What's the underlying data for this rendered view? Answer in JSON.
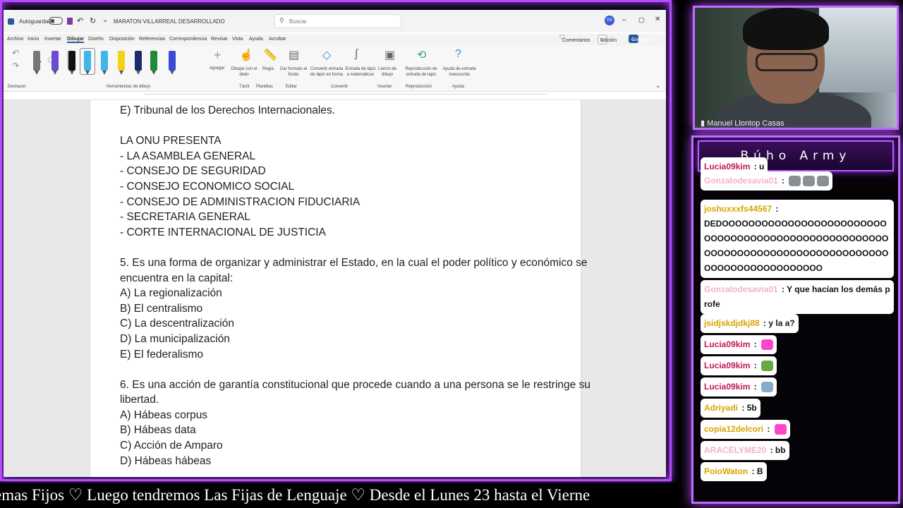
{
  "word": {
    "autosave_label": "Autoguardado",
    "doc_title": "MARATON VILLARREAL DESARROLLADO",
    "search_placeholder": "Buscar",
    "avatar_initials": "SS",
    "tabs": [
      "Archivo",
      "Inicio",
      "Insertar",
      "Dibujar",
      "Diseño",
      "Disposición",
      "Referencias",
      "Correspondencia",
      "Revisar",
      "Vista",
      "Ayuda",
      "Acrobat"
    ],
    "comments_label": "Comentarios",
    "edit_label": "Edición",
    "share_label": "Compartir",
    "ribbon": {
      "undo_group": "Deshacer",
      "tools_group": "Herramientas de dibujo",
      "add_label": "Agregar",
      "draw_finger": "Dibujar con el dedo",
      "ruler": "Regla",
      "format_bg": "Dar formato al fondo",
      "ink_to_text": "Convertir entrada de lápiz en forma",
      "ink_math": "Entrada de lápiz a matemáticas",
      "canvas": "Lienzo de dibujo",
      "replay": "Reproducción de entrada de lápiz",
      "help_ink": "Ayuda de entrada manuscrita",
      "group_tactil": "Táctil",
      "group_plantillas": "Plantillas",
      "group_editar": "Editar",
      "group_convertir": "Convertir",
      "group_insertar": "Insertar",
      "group_reproduccion": "Reproducción",
      "group_ayuda": "Ayuda"
    },
    "pen_colors": [
      "#777777",
      "#6a4bd1",
      "#111111",
      "#3fb6e8",
      "#3fb6e8",
      "#f2d21b",
      "#1a2a6e",
      "#1c8b3c",
      "#3a4bd8"
    ],
    "doc_lines": [
      "E) Tribunal de los Derechos Internacionales.",
      "",
      "LA ONU PRESENTA",
      "- LA ASAMBLEA GENERAL",
      "- CONSEJO DE SEGURIDAD",
      "- CONSEJO ECONOMICO SOCIAL",
      "- CONSEJO DE ADMINISTRACION FIDUCIARIA",
      "- SECRETARIA GENERAL",
      "- CORTE INTERNACIONAL DE JUSTICIA",
      "",
      "5. Es una forma de organizar y administrar el Estado, en la cual el poder político y económico se",
      "encuentra en la capital:",
      "A) La regionalización",
      "B) El centralismo",
      "C) La descentralización",
      "D) La municipalización",
      "E) El federalismo",
      "",
      "6. Es una acción de garantía constitucional que procede cuando a una persona se le restringe su",
      "libertad.",
      "A) Hábeas corpus",
      "B) Hábeas data",
      "C) Acción de Amparo",
      "D) Hábeas hábeas"
    ]
  },
  "cam": {
    "name": "Manuel Llontop Casas"
  },
  "chat": {
    "title": "Búho Army",
    "messages": [
      {
        "user": "Lucia09kim",
        "text": "u",
        "color": "#c2185b"
      },
      {
        "user": "Gonzalodesavia01",
        "text": "",
        "color": "#f3b2c7",
        "emotes": 3
      },
      {
        "user": "joshuxxxfs44567",
        "text": "DEDOOOOOOOOOOOOOOOOOOOOOOOOOOOOOOOOOOOOOOOOOOOOOOOOOOOOOOOOOOOOOOOOOOOOOOOOOOOOOOOOOOOOOOOOOOOOOOOOOOO",
        "color": "#d9a400"
      },
      {
        "user": "Gonzalodesavia01",
        "text": "Y que hacían los demás profe",
        "color": "#f3b2c7"
      },
      {
        "user": "jsidjskdjdkj88",
        "text": "y la a?",
        "color": "#d9a400"
      },
      {
        "user": "Lucia09kim",
        "text": "",
        "color": "#c2185b",
        "emotes": 1
      },
      {
        "user": "Lucia09kim",
        "text": "",
        "color": "#c2185b",
        "emotes": 1
      },
      {
        "user": "Lucia09kim",
        "text": "",
        "color": "#c2185b",
        "emotes": 1
      },
      {
        "user": "Adriyadi",
        "text": "5b",
        "color": "#d9a400"
      },
      {
        "user": "copia12delcori",
        "text": "",
        "color": "#d9a400",
        "emotes": 1
      },
      {
        "user": "ARACELYME20",
        "text": "bb",
        "color": "#f3b2c7"
      },
      {
        "user": "PoioWaton",
        "text": "B",
        "color": "#d9a400"
      }
    ]
  },
  "ticker": "emas Fijos   ♡   Luego tendremos Las Fijas de Lenguaje   ♡   Desde el Lunes 23 hasta el Vierne"
}
